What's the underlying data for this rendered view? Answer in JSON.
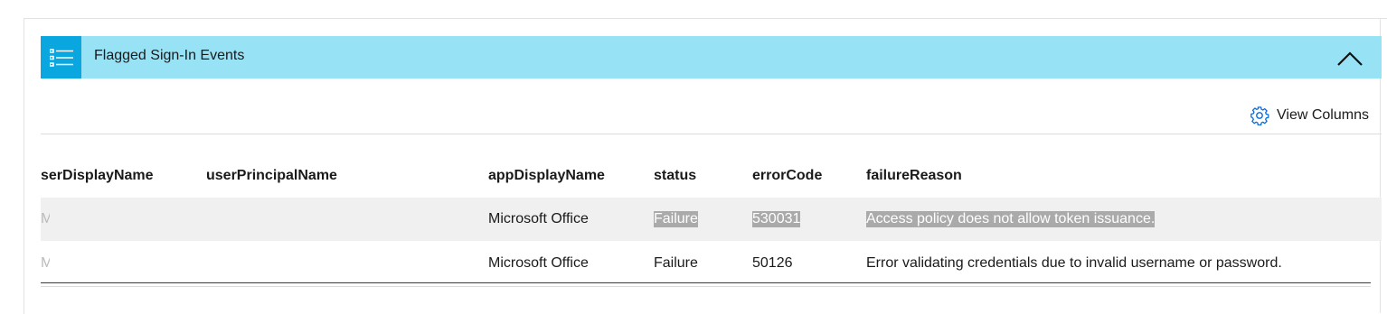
{
  "panel": {
    "title": "Flagged Sign-In Events",
    "icon": "list-icon",
    "collapse_icon": "chevron-up-icon",
    "header_color": "#98e2f6",
    "icon_bg_color": "#0aa6e0"
  },
  "toolbar": {
    "view_columns_label": "View Columns",
    "view_columns_icon": "gear-icon"
  },
  "table": {
    "columns": [
      "serDisplayName",
      "userPrincipalName",
      "appDisplayName",
      "status",
      "errorCode",
      "failureReason"
    ],
    "rows": [
      {
        "userDisplayName": "Ma",
        "userPrincipalName": "",
        "appDisplayName": "Microsoft Office",
        "status": "Failure",
        "errorCode": "530031",
        "failureReason": "Access policy does not allow token issuance.",
        "selected": true
      },
      {
        "userDisplayName": "M",
        "userPrincipalName": "",
        "appDisplayName": "Microsoft Office",
        "status": "Failure",
        "errorCode": "50126",
        "failureReason": "Error validating credentials due to invalid username or password.",
        "selected": false
      }
    ]
  }
}
